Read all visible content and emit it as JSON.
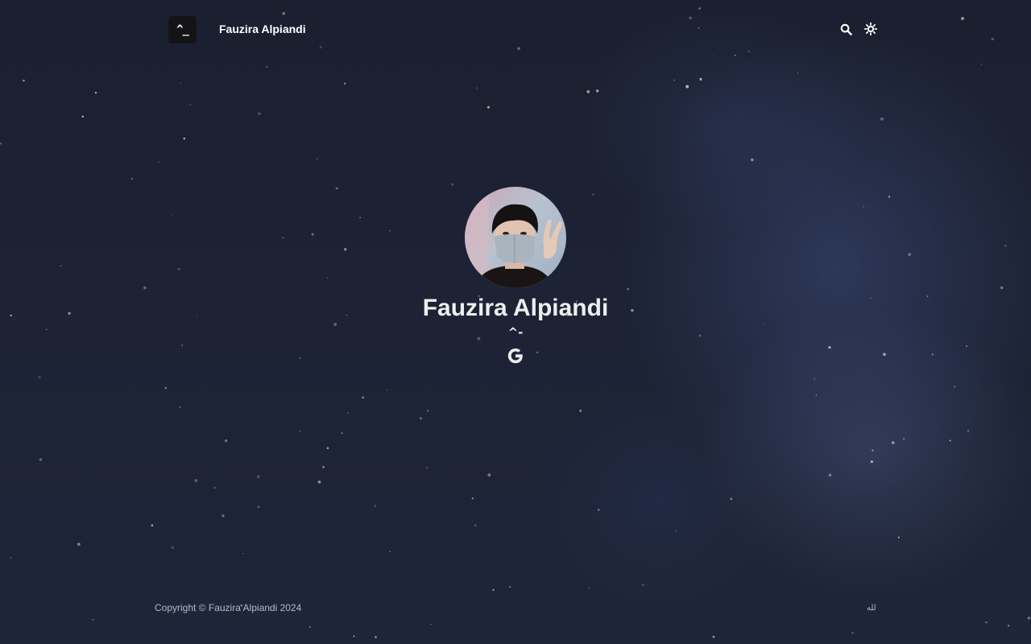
{
  "header": {
    "logo_text": "^_",
    "site_title": "Fauzira Alpiandi",
    "search_icon": "search-icon",
    "theme_toggle_icon": "sun-icon"
  },
  "profile": {
    "avatar_alt": "Fauzira Alpiandi",
    "name": "Fauzira Alpiandi",
    "subtitle": "^-",
    "social_icon": "google-icon"
  },
  "footer": {
    "copyright": "Copyright © Fauzira Alpiandi 2024",
    "mark": "لله"
  },
  "colors": {
    "background": "#1c2233",
    "text": "#eeeeef",
    "logo_bg": "#141416",
    "muted": "#b7bac4"
  }
}
